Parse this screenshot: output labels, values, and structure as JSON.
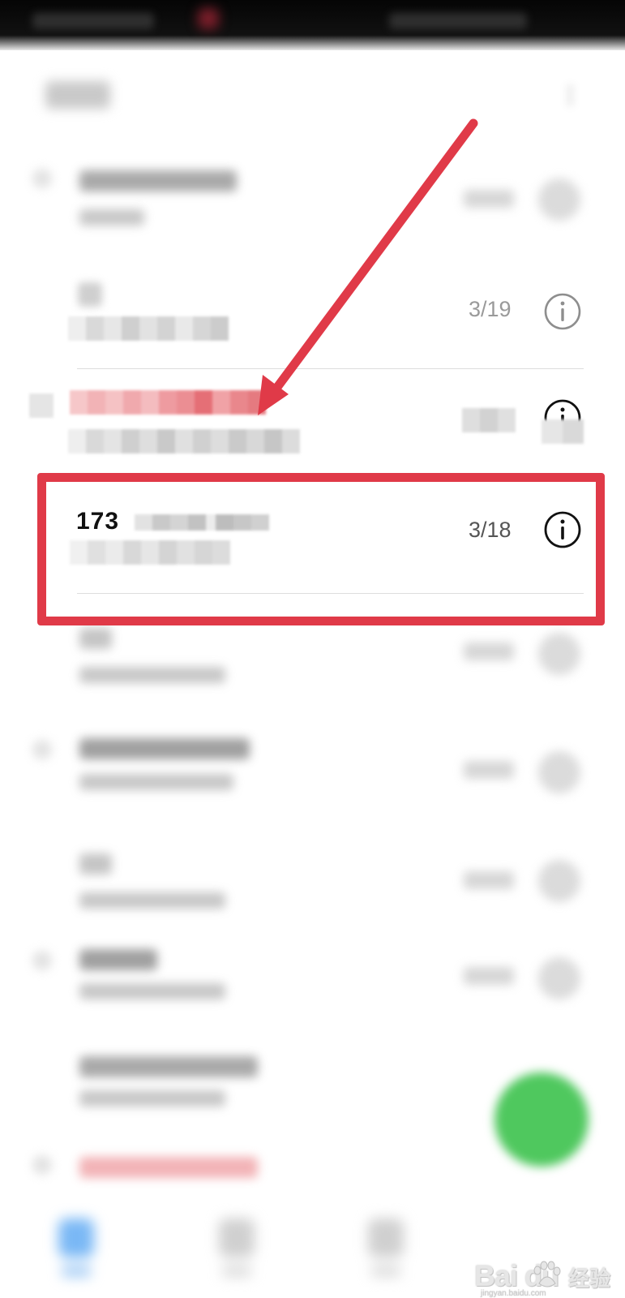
{
  "status_bar": {},
  "header": {
    "menu_icon": "more-vertical-icon"
  },
  "rows": [
    {
      "date": "3/19",
      "icon": "info-icon"
    },
    {
      "icon": "info-icon"
    },
    {
      "name_prefix": "173",
      "date": "3/18",
      "icon": "info-icon"
    }
  ],
  "colors": {
    "highlight": "#e03a48",
    "fab": "#4fc85e",
    "accent_blue": "#2b8cf0"
  },
  "watermark": {
    "brand": "Bai du",
    "cn": "经验",
    "url": "jingyan.baidu.com"
  }
}
